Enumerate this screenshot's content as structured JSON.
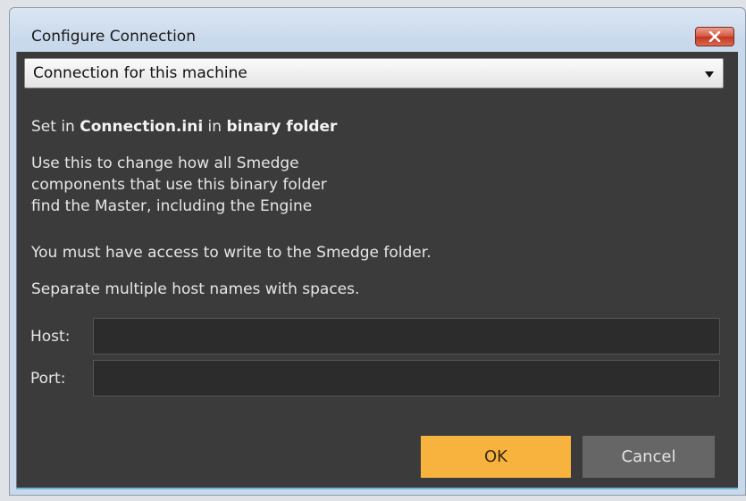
{
  "window": {
    "title": "Configure Connection",
    "close_icon": "close-x-icon"
  },
  "connection_select": {
    "selected": "Connection for this machine"
  },
  "info": {
    "line1_prefix": "Set in ",
    "line1_file": "Connection.ini",
    "line1_mid": " in ",
    "line1_folder": "binary folder",
    "paragraph": [
      "Use this to change how all Smedge",
      "components that use this binary folder",
      "find the Master, including the Engine"
    ],
    "access_note": "You must have access to write to the Smedge folder.",
    "hosts_note": "Separate multiple host names with spaces."
  },
  "fields": {
    "host_label": "Host:",
    "host_value": "",
    "port_label": "Port:",
    "port_value": ""
  },
  "buttons": {
    "ok": "OK",
    "cancel": "Cancel"
  },
  "colors": {
    "ok_accent": "#f7b33e",
    "panel_bg": "#3b3b3b",
    "cancel_bg": "#666666",
    "close_red": "#c3341f"
  }
}
